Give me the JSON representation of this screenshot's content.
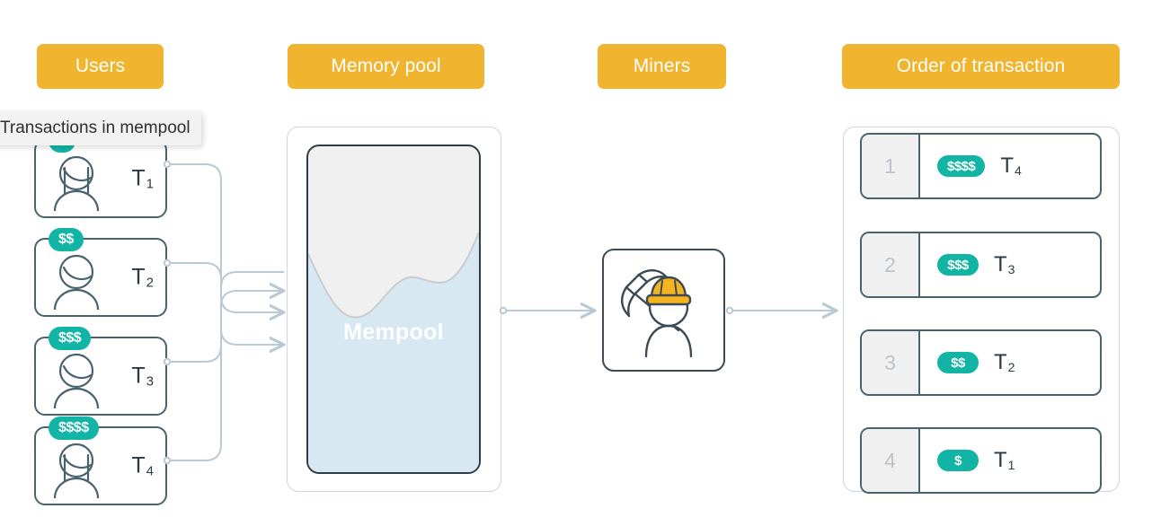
{
  "headers": {
    "users": "Users",
    "memory_pool": "Memory pool",
    "miners": "Miners",
    "order": "Order of transaction"
  },
  "tooltip": {
    "text": "Transactions in mempool"
  },
  "users": {
    "cards": [
      {
        "badge": "$",
        "label": "T",
        "index": "1",
        "avatar": "avatar-long-hair-icon"
      },
      {
        "badge": "$$",
        "label": "T",
        "index": "2",
        "avatar": "avatar-short-hair-icon"
      },
      {
        "badge": "$$$",
        "label": "T",
        "index": "3",
        "avatar": "avatar-short-hair-icon"
      },
      {
        "badge": "$$$$",
        "label": "T",
        "index": "4",
        "avatar": "avatar-long-hair-icon"
      }
    ]
  },
  "mempool": {
    "label": "Mempool",
    "fill_level_percent": 72
  },
  "miner": {
    "icon": "miner-with-pickaxe-icon"
  },
  "order": {
    "rows": [
      {
        "rank": "1",
        "badge": "$$$$",
        "label": "T",
        "index": "4"
      },
      {
        "rank": "2",
        "badge": "$$$",
        "label": "T",
        "index": "3"
      },
      {
        "rank": "3",
        "badge": "$$",
        "label": "T",
        "index": "2"
      },
      {
        "rank": "4",
        "badge": "$",
        "label": "T",
        "index": "1"
      }
    ]
  },
  "colors": {
    "header_amber": "#f0b42e",
    "badge_teal": "#12b4a5",
    "outline_slate": "#48626e",
    "liquid_blue": "#d7e8f2",
    "empty_gray": "#f0f0f0",
    "wire_gray": "#b9cad4",
    "helmet_yellow": "#f5b41f"
  }
}
